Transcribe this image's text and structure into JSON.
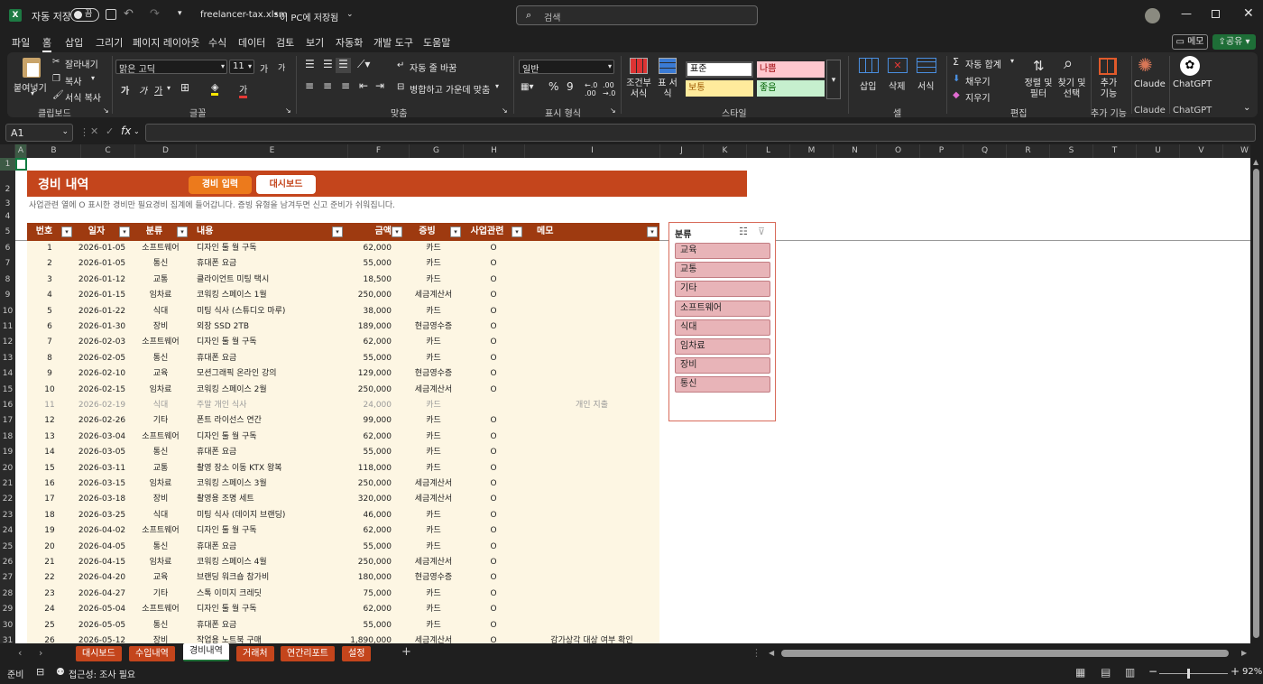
{
  "titlebar": {
    "autosave_label": "자동 저장",
    "toggle_state": "끔",
    "filename": "freelancer-tax.xlsm",
    "save_state": "이 PC에 저장됨",
    "search_placeholder": "검색"
  },
  "menu": [
    "파일",
    "홈",
    "삽입",
    "그리기",
    "페이지 레이아웃",
    "수식",
    "데이터",
    "검토",
    "보기",
    "자동화",
    "개발 도구",
    "도움말"
  ],
  "menu_right": {
    "comment": "메모",
    "share": "공유"
  },
  "ribbon": {
    "clipboard": {
      "paste": "붙여넣기",
      "cut": "잘라내기",
      "copy": "복사",
      "format_painter": "서식 복사",
      "group": "클립보드"
    },
    "font": {
      "name": "맑은 고딕",
      "size": "11",
      "group": "글꼴",
      "grow": "가",
      "shrink": "가",
      "bold": "가",
      "italic": "가",
      "underline": "가",
      "font_color": "가"
    },
    "align": {
      "wrap": "자동 줄 바꿈",
      "merge": "병합하고 가운데 맞춤",
      "group": "맞춤"
    },
    "number": {
      "format": "일반",
      "group": "표시 형식"
    },
    "styles": {
      "cond_format": "조건부 서식",
      "table_format": "표 서식",
      "normal": "표준",
      "bad": "나쁨",
      "neutral": "보통",
      "good": "좋음",
      "group": "스타일"
    },
    "cells": {
      "insert": "삽입",
      "delete": "삭제",
      "format": "서식",
      "group": "셀"
    },
    "editing": {
      "autosum": "자동 합계",
      "fill": "채우기",
      "clear": "지우기",
      "sort": "정렬 및 필터",
      "find": "찾기 및 선택",
      "group": "편집"
    },
    "addins": {
      "label": "추가 기능",
      "group": "추가 기능"
    },
    "claude": {
      "label": "Claude",
      "group": "Claude"
    },
    "chatgpt": {
      "label": "ChatGPT",
      "group": "ChatGPT"
    }
  },
  "formula_bar": {
    "cell_ref": "A1",
    "fx": "fx",
    "formula": ""
  },
  "columns": [
    "A",
    "B",
    "C",
    "D",
    "E",
    "F",
    "G",
    "H",
    "I",
    "J",
    "K",
    "L",
    "M",
    "N",
    "O",
    "P",
    "Q",
    "R",
    "S",
    "T",
    "U",
    "V",
    "W"
  ],
  "rows": [
    "1",
    "2",
    "3",
    "4",
    "5",
    "6",
    "7",
    "8",
    "9",
    "10",
    "11",
    "12",
    "13",
    "14",
    "15",
    "16",
    "17",
    "18",
    "19",
    "20",
    "21",
    "22",
    "23",
    "24",
    "25",
    "26",
    "27",
    "28",
    "29",
    "30",
    "31"
  ],
  "sheet": {
    "title": "경비 내역",
    "btn_input": "경비 입력",
    "btn_dashboard": "대시보드",
    "note": "사업관련 열에 O 표시한 경비만 필요경비 집계에 들어갑니다. 증빙 유형을 남겨두면 신고 준비가 쉬워집니다.",
    "headers": [
      "번호",
      "일자",
      "분류",
      "내용",
      "금액",
      "증빙",
      "사업관련",
      "메모"
    ],
    "rows": [
      [
        "1",
        "2026-01-05",
        "소프트웨어",
        "디자인 툴 월 구독",
        "62,000",
        "카드",
        "O",
        ""
      ],
      [
        "2",
        "2026-01-05",
        "통신",
        "휴대폰 요금",
        "55,000",
        "카드",
        "O",
        ""
      ],
      [
        "3",
        "2026-01-12",
        "교통",
        "클라이언트 미팅 택시",
        "18,500",
        "카드",
        "O",
        ""
      ],
      [
        "4",
        "2026-01-15",
        "임차료",
        "코워킹 스페이스 1월",
        "250,000",
        "세금계산서",
        "O",
        ""
      ],
      [
        "5",
        "2026-01-22",
        "식대",
        "미팅 식사 (스튜디오 마루)",
        "38,000",
        "카드",
        "O",
        ""
      ],
      [
        "6",
        "2026-01-30",
        "장비",
        "외장 SSD 2TB",
        "189,000",
        "현금영수증",
        "O",
        ""
      ],
      [
        "7",
        "2026-02-03",
        "소프트웨어",
        "디자인 툴 월 구독",
        "62,000",
        "카드",
        "O",
        ""
      ],
      [
        "8",
        "2026-02-05",
        "통신",
        "휴대폰 요금",
        "55,000",
        "카드",
        "O",
        ""
      ],
      [
        "9",
        "2026-02-10",
        "교육",
        "모션그래픽 온라인 강의",
        "129,000",
        "현금영수증",
        "O",
        ""
      ],
      [
        "10",
        "2026-02-15",
        "임차료",
        "코워킹 스페이스 2월",
        "250,000",
        "세금계산서",
        "O",
        ""
      ],
      [
        "11",
        "2026-02-19",
        "식대",
        "주말 개인 식사",
        "24,000",
        "카드",
        "",
        "개인 지출"
      ],
      [
        "12",
        "2026-02-26",
        "기타",
        "폰트 라이선스 연간",
        "99,000",
        "카드",
        "O",
        ""
      ],
      [
        "13",
        "2026-03-04",
        "소프트웨어",
        "디자인 툴 월 구독",
        "62,000",
        "카드",
        "O",
        ""
      ],
      [
        "14",
        "2026-03-05",
        "통신",
        "휴대폰 요금",
        "55,000",
        "카드",
        "O",
        ""
      ],
      [
        "15",
        "2026-03-11",
        "교통",
        "촬영 장소 이동 KTX 왕복",
        "118,000",
        "카드",
        "O",
        ""
      ],
      [
        "16",
        "2026-03-15",
        "임차료",
        "코워킹 스페이스 3월",
        "250,000",
        "세금계산서",
        "O",
        ""
      ],
      [
        "17",
        "2026-03-18",
        "장비",
        "촬영용 조명 세트",
        "320,000",
        "세금계산서",
        "O",
        ""
      ],
      [
        "18",
        "2026-03-25",
        "식대",
        "미팅 식사 (데이지 브랜딩)",
        "46,000",
        "카드",
        "O",
        ""
      ],
      [
        "19",
        "2026-04-02",
        "소프트웨어",
        "디자인 툴 월 구독",
        "62,000",
        "카드",
        "O",
        ""
      ],
      [
        "20",
        "2026-04-05",
        "통신",
        "휴대폰 요금",
        "55,000",
        "카드",
        "O",
        ""
      ],
      [
        "21",
        "2026-04-15",
        "임차료",
        "코워킹 스페이스 4월",
        "250,000",
        "세금계산서",
        "O",
        ""
      ],
      [
        "22",
        "2026-04-20",
        "교육",
        "브랜딩 워크숍 참가비",
        "180,000",
        "현금영수증",
        "O",
        ""
      ],
      [
        "23",
        "2026-04-27",
        "기타",
        "스톡 이미지 크레딧",
        "75,000",
        "카드",
        "O",
        ""
      ],
      [
        "24",
        "2026-05-04",
        "소프트웨어",
        "디자인 툴 월 구독",
        "62,000",
        "카드",
        "O",
        ""
      ],
      [
        "25",
        "2026-05-05",
        "통신",
        "휴대폰 요금",
        "55,000",
        "카드",
        "O",
        ""
      ],
      [
        "26",
        "2026-05-12",
        "장비",
        "작업용 노트북 구매",
        "1,890,000",
        "세금계산서",
        "O",
        "감가상각 대상 여부 확인"
      ]
    ]
  },
  "slicer": {
    "title": "분류",
    "items": [
      "교육",
      "교통",
      "기타",
      "소프트웨어",
      "식대",
      "임차료",
      "장비",
      "통신"
    ]
  },
  "tabs": [
    "대시보드",
    "수입내역",
    "경비내역",
    "거래처",
    "연간리포트",
    "설정"
  ],
  "status": {
    "ready": "준비",
    "accessibility": "접근성: 조사 필요",
    "zoom": "92%"
  },
  "colors": {
    "accent": "#c4451c",
    "header_row": "#9e3a10",
    "row_band": "#fdf6e3",
    "slicer_item": "#e8b4b8"
  }
}
